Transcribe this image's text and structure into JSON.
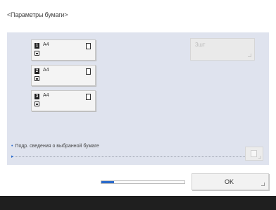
{
  "screen": {
    "title": "<Параметры бумаги>"
  },
  "slots": [
    {
      "number": "1",
      "size": "A4"
    },
    {
      "number": "2",
      "size": "A4"
    },
    {
      "number": "3",
      "size": "A4"
    }
  ],
  "quantity": {
    "label": "3шт"
  },
  "info": {
    "bullet": "•",
    "text": "Подр. сведения о выбранной бумаге",
    "arrow": "▸"
  },
  "progress": {
    "fraction": 0.15,
    "color": "#2a6acb"
  },
  "actions": {
    "ok_label": "OK"
  },
  "colors": {
    "panel_bg": "#dfe3ee",
    "accent": "#2a6acb",
    "footer_bg": "#1f1f1f"
  }
}
